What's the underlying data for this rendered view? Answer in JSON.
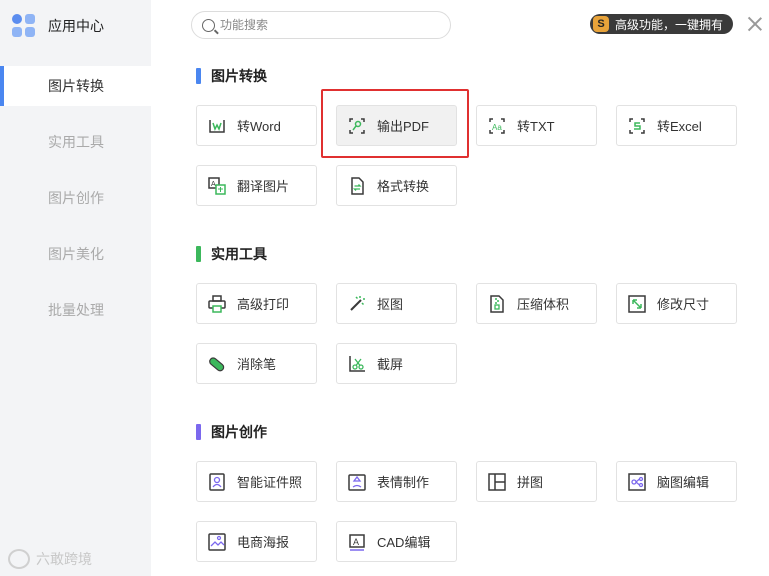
{
  "app": {
    "title": "应用中心"
  },
  "search": {
    "placeholder": "功能搜索",
    "value": ""
  },
  "premium": {
    "label": "高级功能，一键拥有",
    "icon": "S"
  },
  "sidebar": {
    "items": [
      {
        "label": "图片转换",
        "active": true
      },
      {
        "label": "实用工具",
        "active": false
      },
      {
        "label": "图片创作",
        "active": false
      },
      {
        "label": "图片美化",
        "active": false
      },
      {
        "label": "批量处理",
        "active": false
      }
    ]
  },
  "watermark": {
    "text": "六敢跨境"
  },
  "sections": [
    {
      "title": "图片转换",
      "color": "#4a86f0",
      "tools": [
        {
          "label": "转Word",
          "icon": "word-icon"
        },
        {
          "label": "输出PDF",
          "icon": "pdf-icon"
        },
        {
          "label": "转TXT",
          "icon": "txt-icon"
        },
        {
          "label": "转Excel",
          "icon": "excel-icon"
        },
        {
          "label": "翻译图片",
          "icon": "translate-icon"
        },
        {
          "label": "格式转换",
          "icon": "format-convert-icon"
        }
      ]
    },
    {
      "title": "实用工具",
      "color": "#3cb85c",
      "tools": [
        {
          "label": "高级打印",
          "icon": "printer-icon"
        },
        {
          "label": "抠图",
          "icon": "magic-wand-icon"
        },
        {
          "label": "压缩体积",
          "icon": "compress-icon"
        },
        {
          "label": "修改尺寸",
          "icon": "resize-icon"
        },
        {
          "label": "消除笔",
          "icon": "eraser-icon"
        },
        {
          "label": "截屏",
          "icon": "scissors-icon"
        }
      ]
    },
    {
      "title": "图片创作",
      "color": "#7b68ee",
      "tools": [
        {
          "label": "智能证件照",
          "icon": "id-photo-icon"
        },
        {
          "label": "表情制作",
          "icon": "emoji-icon"
        },
        {
          "label": "拼图",
          "icon": "collage-icon"
        },
        {
          "label": "脑图编辑",
          "icon": "mindmap-icon"
        },
        {
          "label": "电商海报",
          "icon": "poster-icon"
        },
        {
          "label": "CAD编辑",
          "icon": "cad-icon"
        }
      ]
    }
  ],
  "colors": {
    "accent": "#4a86f0",
    "highlight": "#e03030",
    "icon_green": "#3cb85c",
    "icon_dark": "#3a3a3a"
  }
}
